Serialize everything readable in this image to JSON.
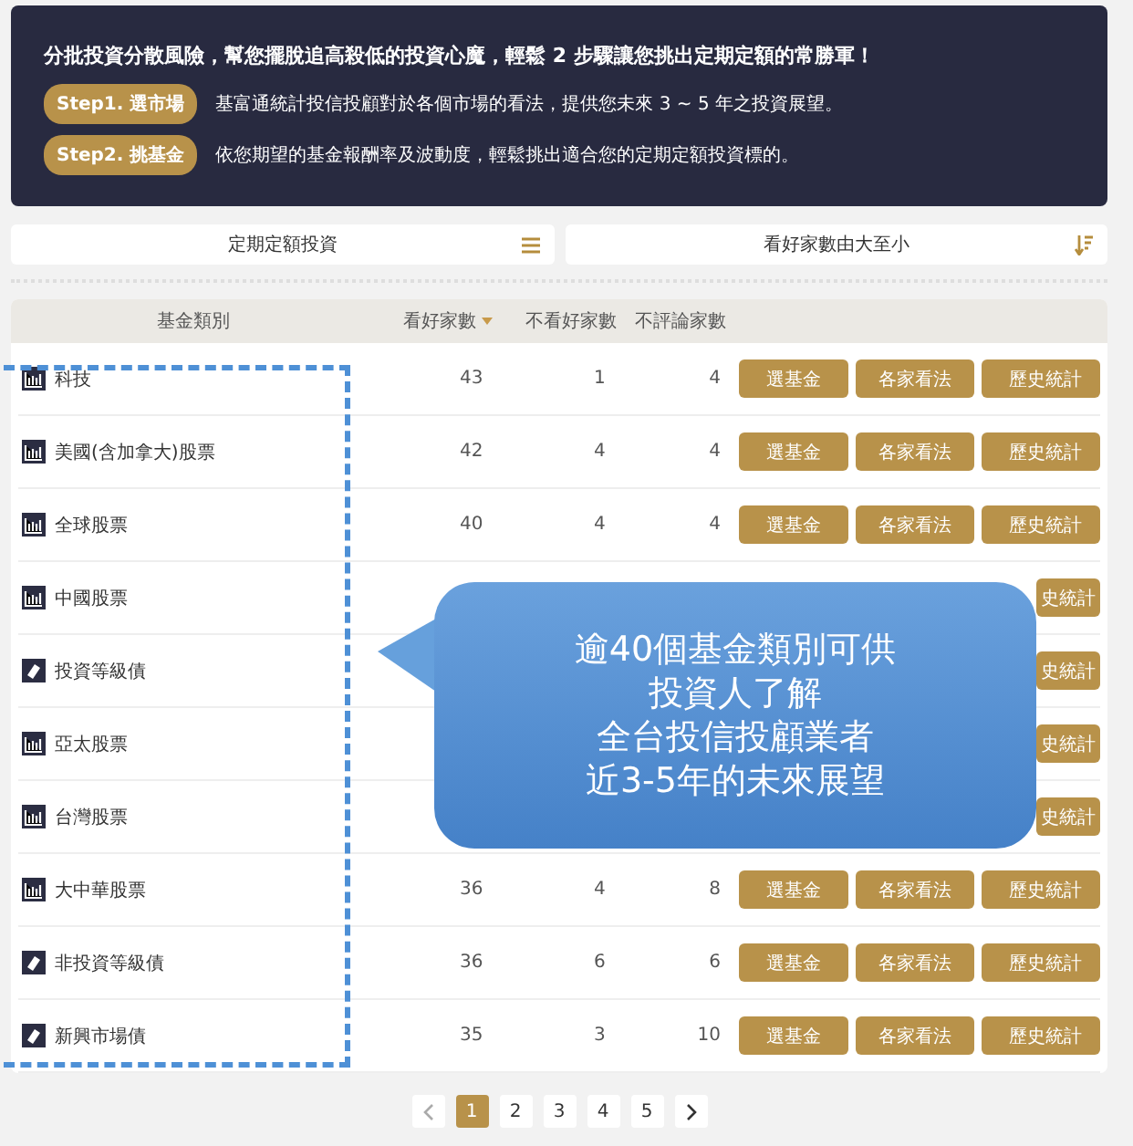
{
  "banner": {
    "title": "分批投資分散風險，幫您擺脫追高殺低的投資心魔，輕鬆 2 步驟讓您挑出定期定額的常勝軍！",
    "steps": [
      {
        "badge": "Step1. 選市場",
        "text": "基富通統計投信投顧對於各個市場的看法，提供您未來 3 ~ 5 年之投資展望。"
      },
      {
        "badge": "Step2. 挑基金",
        "text": "依您期望的基金報酬率及波動度，輕鬆挑出適合您的定期定額投資標的。"
      }
    ]
  },
  "filters": [
    {
      "value": "定期定額投資",
      "kind": "menu"
    },
    {
      "value": "看好家數由大至小",
      "kind": "sort"
    }
  ],
  "table": {
    "columns": [
      {
        "label": "基金類別",
        "sorted": false
      },
      {
        "label": "看好家數",
        "sorted": true
      },
      {
        "label": "不看好家數",
        "sorted": false
      },
      {
        "label": "不評論家數",
        "sorted": false
      }
    ],
    "rows": [
      {
        "kind": "equity",
        "name": "科技",
        "bullish": "43",
        "bearish": "1",
        "neutral": "4",
        "buttons": [
          {
            "label": "選基金"
          },
          {
            "label": "各家看法"
          },
          {
            "label": "歷史統計"
          }
        ]
      },
      {
        "kind": "equity",
        "name": "美國(含加拿大)股票",
        "bullish": "42",
        "bearish": "4",
        "neutral": "4",
        "buttons": [
          {
            "label": "選基金"
          },
          {
            "label": "各家看法"
          },
          {
            "label": "歷史統計"
          }
        ]
      },
      {
        "kind": "equity",
        "name": "全球股票",
        "bullish": "40",
        "bearish": "4",
        "neutral": "4",
        "buttons": [
          {
            "label": "選基金"
          },
          {
            "label": "各家看法"
          },
          {
            "label": "歷史統計"
          }
        ]
      },
      {
        "kind": "equity",
        "name": "中國股票",
        "buttons": [
          {
            "label": "史統計",
            "partial": true
          }
        ]
      },
      {
        "kind": "bond",
        "name": "投資等級債",
        "buttons": [
          {
            "label": "史統計",
            "partial": true
          }
        ]
      },
      {
        "kind": "equity",
        "name": "亞太股票",
        "buttons": [
          {
            "label": "史統計",
            "partial": true
          }
        ]
      },
      {
        "kind": "equity",
        "name": "台灣股票",
        "buttons": [
          {
            "label": "史統計",
            "partial": true
          }
        ]
      },
      {
        "kind": "equity",
        "name": "大中華股票",
        "bullish": "36",
        "bearish": "4",
        "neutral": "8",
        "buttons": [
          {
            "label": "選基金"
          },
          {
            "label": "各家看法"
          },
          {
            "label": "歷史統計"
          }
        ]
      },
      {
        "kind": "bond",
        "name": "非投資等級債",
        "bullish": "36",
        "bearish": "6",
        "neutral": "6",
        "buttons": [
          {
            "label": "選基金"
          },
          {
            "label": "各家看法"
          },
          {
            "label": "歷史統計"
          }
        ]
      },
      {
        "kind": "bond",
        "name": "新興市場債",
        "bullish": "35",
        "bearish": "3",
        "neutral": "10",
        "buttons": [
          {
            "label": "選基金"
          },
          {
            "label": "各家看法"
          },
          {
            "label": "歷史統計"
          }
        ]
      }
    ]
  },
  "callout": {
    "lines": [
      "逾40個基金類別可供",
      "投資人了解",
      "全台投信投顧業者",
      "近3-5年的未來展望"
    ]
  },
  "pagination": {
    "pages": [
      {
        "label": "1",
        "selected": true
      },
      {
        "label": "2",
        "selected": false
      },
      {
        "label": "3",
        "selected": false
      },
      {
        "label": "4",
        "selected": false
      },
      {
        "label": "5",
        "selected": false
      }
    ]
  }
}
